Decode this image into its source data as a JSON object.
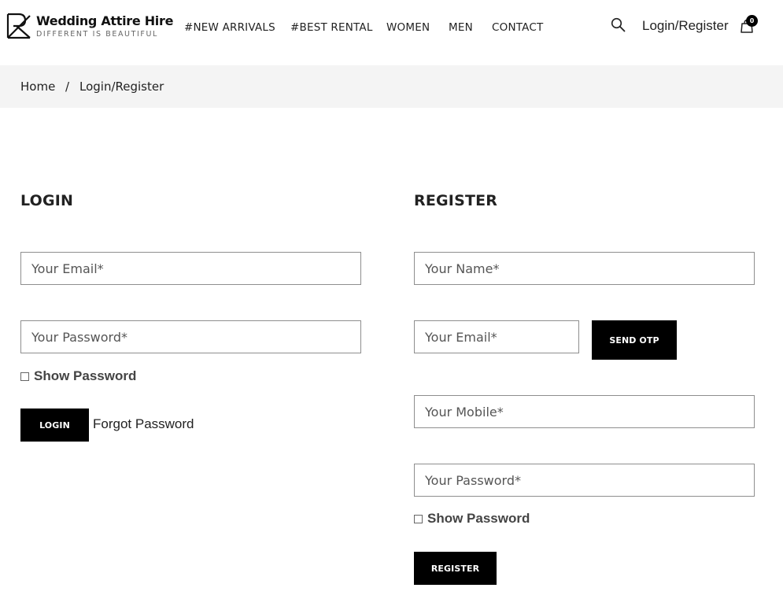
{
  "brand": {
    "name": "Wedding Attire Hire",
    "tagline": "DIFFERENT IS BEAUTIFUL"
  },
  "nav": {
    "items": [
      "#NEW ARRIVALS",
      "#BEST RENTAL",
      "WOMEN",
      "MEN",
      "CONTACT"
    ],
    "login_register": "Login/Register",
    "cart_count": "0"
  },
  "breadcrumb": {
    "home": "Home",
    "separator": "/",
    "current": "Login/Register"
  },
  "login": {
    "title": "LOGIN",
    "email_placeholder": "Your Email*",
    "password_placeholder": "Your Password*",
    "show_password": "Show Password",
    "button": "LOGIN",
    "forgot": "Forgot Password"
  },
  "register": {
    "title": "REGISTER",
    "name_placeholder": "Your Name*",
    "email_placeholder": "Your Email*",
    "send_otp": "SEND OTP",
    "mobile_placeholder": "Your Mobile*",
    "password_placeholder": "Your Password*",
    "show_password": "Show Password",
    "button": "REGISTER"
  }
}
